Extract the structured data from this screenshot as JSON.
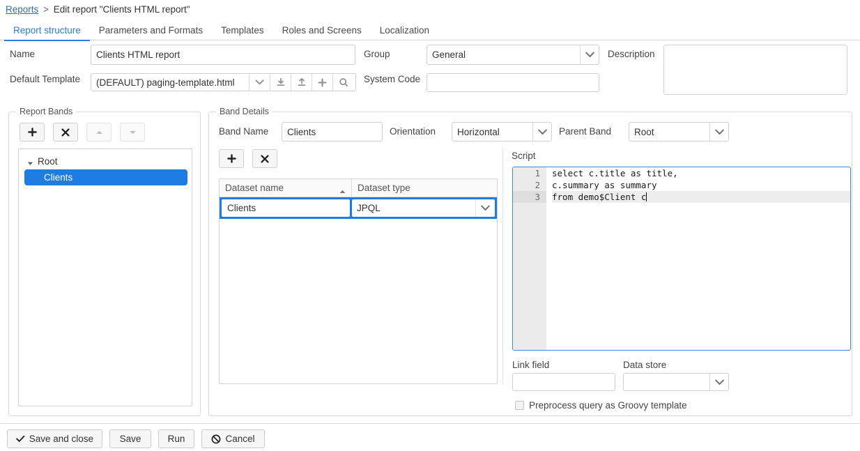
{
  "breadcrumb": {
    "root_label": "Reports",
    "separator": ">",
    "current": "Edit report \"Clients HTML report\""
  },
  "tabs": [
    {
      "label": "Report structure",
      "active": true
    },
    {
      "label": "Parameters and Formats",
      "active": false
    },
    {
      "label": "Templates",
      "active": false
    },
    {
      "label": "Roles and Screens",
      "active": false
    },
    {
      "label": "Localization",
      "active": false
    }
  ],
  "form": {
    "name_label": "Name",
    "name_value": "Clients HTML report",
    "group_label": "Group",
    "group_value": "General",
    "description_label": "Description",
    "description_value": "",
    "default_template_label": "Default Template",
    "default_template_value": "(DEFAULT) paging-template.html",
    "system_code_label": "System Code",
    "system_code_value": "",
    "template_buttons": [
      {
        "icon": "chevron-down-icon"
      },
      {
        "icon": "download-icon"
      },
      {
        "icon": "upload-icon"
      },
      {
        "icon": "plus-icon"
      },
      {
        "icon": "search-icon"
      }
    ]
  },
  "report_bands": {
    "legend": "Report Bands",
    "toolbar": [
      {
        "icon": "plus-icon",
        "enabled": true
      },
      {
        "icon": "remove-icon",
        "enabled": true
      },
      {
        "icon": "move-up-icon",
        "enabled": false
      },
      {
        "icon": "move-down-icon",
        "enabled": false
      }
    ],
    "tree": [
      {
        "label": "Root",
        "level": 0,
        "expanded": true,
        "selected": false
      },
      {
        "label": "Clients",
        "level": 1,
        "expanded": false,
        "selected": true
      }
    ]
  },
  "band_details": {
    "legend": "Band Details",
    "band_name_label": "Band Name",
    "band_name_value": "Clients",
    "orientation_label": "Orientation",
    "orientation_value": "Horizontal",
    "parent_band_label": "Parent Band",
    "parent_band_value": "Root",
    "dataset_toolbar": [
      {
        "icon": "plus-icon"
      },
      {
        "icon": "remove-icon"
      }
    ],
    "dataset_table": {
      "columns": [
        {
          "label": "Dataset name",
          "sort": "asc"
        },
        {
          "label": "Dataset type",
          "sort": "none"
        }
      ],
      "rows": [
        {
          "dataset_name": "Clients",
          "dataset_type": "JPQL",
          "editing": true
        }
      ]
    },
    "script_label": "Script",
    "script_lines": [
      "select c.title as title,",
      "c.summary as summary",
      "from demo$Client c"
    ],
    "script_active_line": 3,
    "link_field_label": "Link field",
    "link_field_value": "",
    "data_store_label": "Data store",
    "data_store_value": "",
    "preprocess_label": "Preprocess query as Groovy template",
    "preprocess_checked": false
  },
  "actions": [
    {
      "label": "Save and close",
      "icon": "check-icon"
    },
    {
      "label": "Save",
      "icon": "none"
    },
    {
      "label": "Run",
      "icon": "none"
    },
    {
      "label": "Cancel",
      "icon": "ban-icon"
    }
  ],
  "colors": {
    "accent": "#2e7bd6",
    "selection": "#1e7ce3",
    "link": "#2f6fb3",
    "border": "#d4d4d4",
    "focus": "#3b8ade"
  }
}
